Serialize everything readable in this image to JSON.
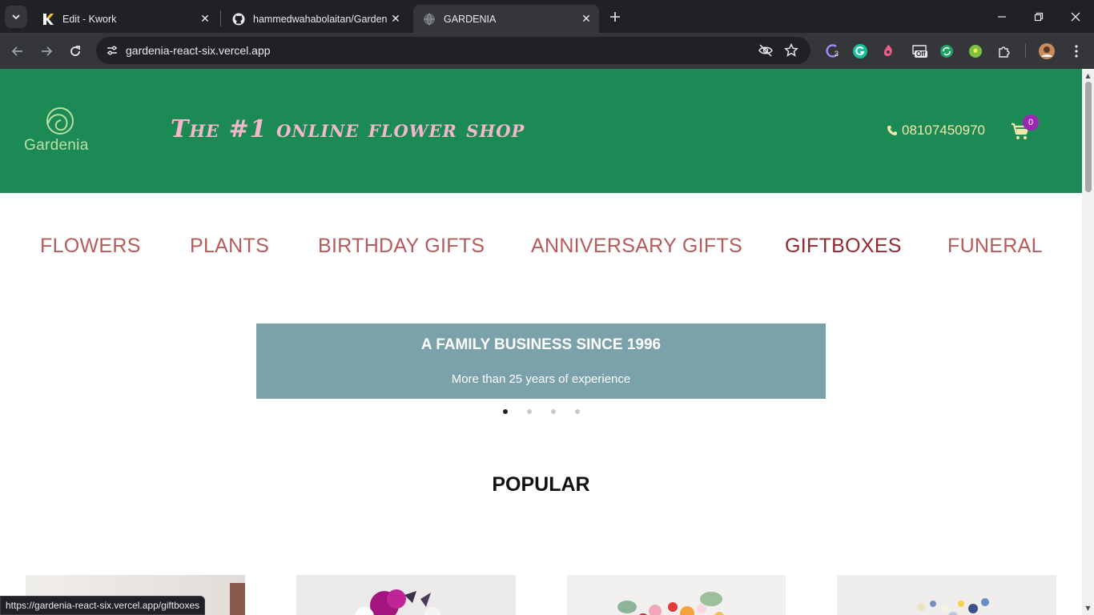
{
  "browser": {
    "tabs": [
      {
        "title": "Edit - Kwork",
        "favicon": "kwork-k-icon"
      },
      {
        "title": "hammedwahabolaitan/Gardenia",
        "favicon": "github-icon"
      },
      {
        "title": "GARDENIA",
        "favicon": "globe-icon",
        "active": true
      }
    ],
    "url": "gardenia-react-six.vercel.app",
    "status_url": "https://gardenia-react-six.vercel.app/giftboxes",
    "extension_badges": {
      "circle_count": "3",
      "off_label": "Off"
    }
  },
  "header": {
    "logo_text": "Gardenia",
    "tagline": "The #1 online flower shop",
    "phone": "08107450970",
    "cart_count": "0",
    "colors": {
      "background": "#1b8a55",
      "tagline": "#f4b7cc",
      "phone": "#f3e7a8",
      "badge": "#9c27b0"
    }
  },
  "nav": {
    "items": [
      {
        "label": "FLOWERS"
      },
      {
        "label": "PLANTS"
      },
      {
        "label": "BIRTHDAY GIFTS"
      },
      {
        "label": "ANNIVERSARY GIFTS"
      },
      {
        "label": "GIFTBOXES",
        "hovered": true
      },
      {
        "label": "FUNERAL"
      }
    ],
    "colors": {
      "default": "#b85a5a",
      "hover": "#96272e"
    }
  },
  "hero": {
    "title": "A FAMILY BUSINESS SINCE 1996",
    "subtitle": "More than 25 years of experience",
    "slide_count": 4,
    "active_slide": 1,
    "color": "#7ba2aa"
  },
  "popular": {
    "heading": "POPULAR",
    "products": [
      {
        "image": "gift-box-image"
      },
      {
        "image": "purple-bouquet-image"
      },
      {
        "image": "colorful-bouquet-image"
      },
      {
        "image": "blue-wildflower-bouquet-image"
      }
    ]
  }
}
